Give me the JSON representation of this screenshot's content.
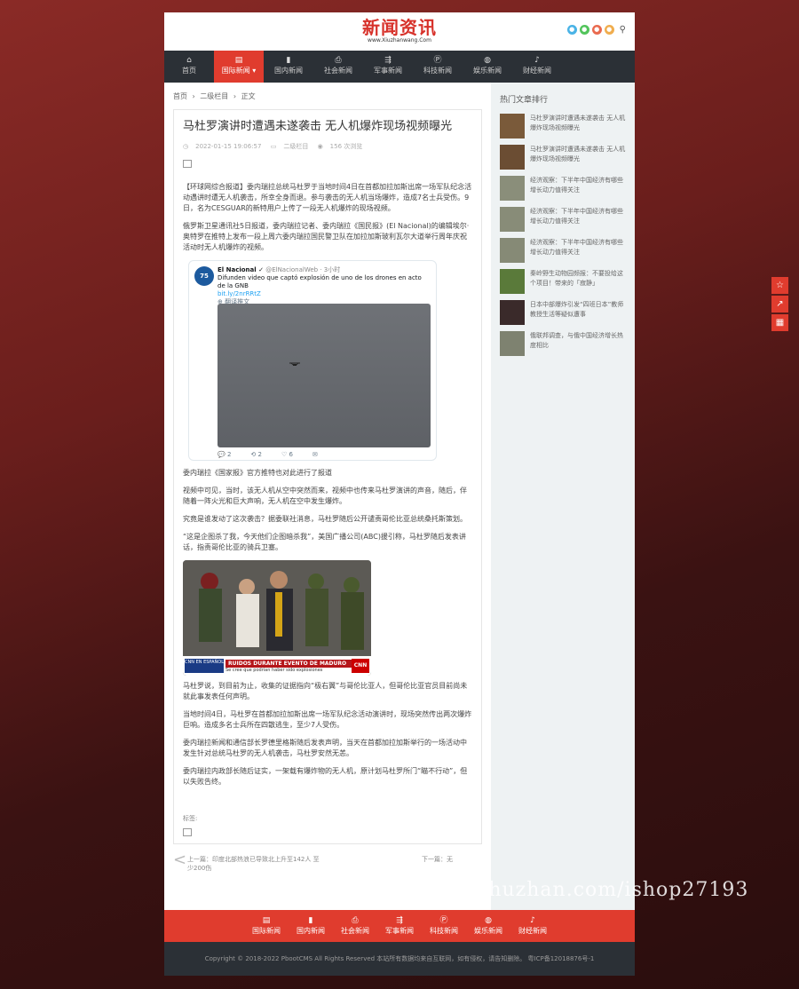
{
  "logo": {
    "title": "新闻资讯",
    "subtitle": "www.Xiuzhanwang.Com"
  },
  "colors": {
    "accent": "#e03c2e",
    "nav_bg": "#2b3036",
    "sidebar_bg": "#eef2f3",
    "brand_red": "#d7312a"
  },
  "social_icons": [
    "qq-icon",
    "wechat-icon",
    "weibo-icon",
    "rss-icon"
  ],
  "nav": {
    "items": [
      {
        "label": "首页",
        "icon": "home-icon"
      },
      {
        "label": "国际新闻 ▾",
        "icon": "book-icon"
      },
      {
        "label": "国内新闻",
        "icon": "bookmark-icon"
      },
      {
        "label": "社会新闻",
        "icon": "print-icon"
      },
      {
        "label": "军事新闻",
        "icon": "usb-icon"
      },
      {
        "label": "科技新闻",
        "icon": "p-icon"
      },
      {
        "label": "娱乐新闻",
        "icon": "globe-icon"
      },
      {
        "label": "财经新闻",
        "icon": "bell-icon"
      }
    ]
  },
  "breadcrumb": {
    "home": "首页",
    "sep": "›",
    "level2": "二级栏目",
    "current": "正文"
  },
  "article": {
    "title": "马杜罗演讲时遭遇未遂袭击 无人机爆炸现场视频曝光",
    "date": "2022-01-15 19:06:57",
    "category": "二级栏目",
    "views": "156 次浏览",
    "p1": "【环球网综合报道】委内瑞拉总统马杜罗于当地时间4日在首都加拉加斯出席一场军队纪念活动遇讲时遭无人机袭击，所幸全身而退。参与袭击的无人机当场爆炸，造成7名士兵受伤。9日，名为CESGUAR的新特用户上传了一段无人机爆炸的现场视频。",
    "p2": "俄罗斯卫星通讯社5日报道，委内瑞拉记者、委内瑞拉《国民报》(El Nacional)的编辑埃尔·奥特罗在推特上发布一段上周六委内瑞拉国民警卫队在加拉加斯玻利瓦尔大道举行周年庆祝活动时无人机爆炸的视频。",
    "caption": "委内瑞拉《国家报》官方推特也对此进行了报道",
    "p3": "视频中可见，当时，该无人机从空中突然而来，视频中也传来马杜罗演讲的声音，随后，伴随着一阵火光和巨大声响，无人机在空中发生爆炸。",
    "p4": "究竟是谁发动了这次袭击？据委联社消息，马杜罗随后公开谴责哥伦比亚总统桑托斯策划。",
    "p5": "“这是企图杀了我，今天他们企图暗杀我”，美国广播公司(ABC)援引称，马杜罗随后发表讲话，指责哥伦比亚的骑兵卫塞。",
    "p6": "马杜罗说，到目前为止，收集的证据指向“极右翼”与哥伦比亚人，但哥伦比亚官员目前尚未就此事发表任何声明。",
    "p7": "当地时间4日，马杜罗在首都加拉加斯出席一场军队纪念活动演讲时，现场突然传出两次爆炸巨响。造成多名士兵所在四散逃生，至少7人受伤。",
    "p8": "委内瑞拉新闻和通信部长罗德里格斯随后发表声明，当天在首都加拉加斯举行的一场活动中发生针对总统马杜罗的无人机袭击，马杜罗安然无恙。",
    "p9": "委内瑞拉内政部长随后证实，一架载有爆炸物的无人机，原计划马杜罗所门“瞄不行动”，但以失败告终。",
    "tags_label": "标签:"
  },
  "tweet": {
    "avatar_text": "75",
    "name": "El Nacional ✓",
    "handle": "@ElNacionalWeb · 3小时",
    "text": "Difunden video que captó explosión de uno de los drones en acto de la GNB",
    "link": "bit.ly/2nrRRtZ",
    "translate": "⊕ 翻译推文",
    "replies": "💬 2",
    "retweets": "⟲ 2",
    "likes": "♡ 6",
    "mail": "✉"
  },
  "photo": {
    "ticker_main": "RUIDOS DURANTE EVENTO DE MADURO",
    "ticker_sub": "Se cree que podrían haber sido explosiones",
    "cnn": "CNN",
    "channel": "CNN EN ESPAÑOL"
  },
  "prevnext": {
    "prev": "上一篇：印度北部热浪已导致北上升至142人 至少200伤",
    "next": "下一篇：无"
  },
  "sidebar": {
    "title": "热门文章排行",
    "items": [
      {
        "text": "马杜罗演讲时遭遇未遂袭击 无人机爆炸现场视频曝光",
        "thumb": "#7a5a3a"
      },
      {
        "text": "马杜罗演讲时遭遇未遂袭击 无人机爆炸现场视频曝光",
        "thumb": "#6b4d33"
      },
      {
        "text": "经济观察：下半年中国经济有哪些增长动力值得关注",
        "thumb": "#8a8e7a"
      },
      {
        "text": "经济观察：下半年中国经济有哪些增长动力值得关注",
        "thumb": "#888c78"
      },
      {
        "text": "经济观察：下半年中国经济有哪些增长动力值得关注",
        "thumb": "#868a76"
      },
      {
        "text": "秦岭野生动物园频报：不要投给这个项目！带来的「寂静」",
        "thumb": "#5a7a3a"
      },
      {
        "text": "日本中部爆炸引发“四班日本”教师教授生活等疑似遭事",
        "thumb": "#3a2a2a"
      },
      {
        "text": "俄联邦调查，与俄中国经济增长热度相比",
        "thumb": "#7e8270"
      }
    ]
  },
  "footer_nav": [
    {
      "label": "国际新闻",
      "icon": "book-icon"
    },
    {
      "label": "国内新闻",
      "icon": "bookmark-icon"
    },
    {
      "label": "社会新闻",
      "icon": "print-icon"
    },
    {
      "label": "军事新闻",
      "icon": "usb-icon"
    },
    {
      "label": "科技新闻",
      "icon": "p-icon"
    },
    {
      "label": "娱乐新闻",
      "icon": "globe-icon"
    },
    {
      "label": "财经新闻",
      "icon": "bell-icon"
    }
  ],
  "copyright": "Copyright © 2018-2022 PbootCMS All Rights Reserved 本站所有数据均来自互联网，如有侵权，请告知删除。 粤ICP备12018876号-1",
  "float_buttons": [
    "star-icon",
    "share-icon",
    "qrcode-icon"
  ],
  "watermark": "https://www.huzhan.com/ishop27193"
}
